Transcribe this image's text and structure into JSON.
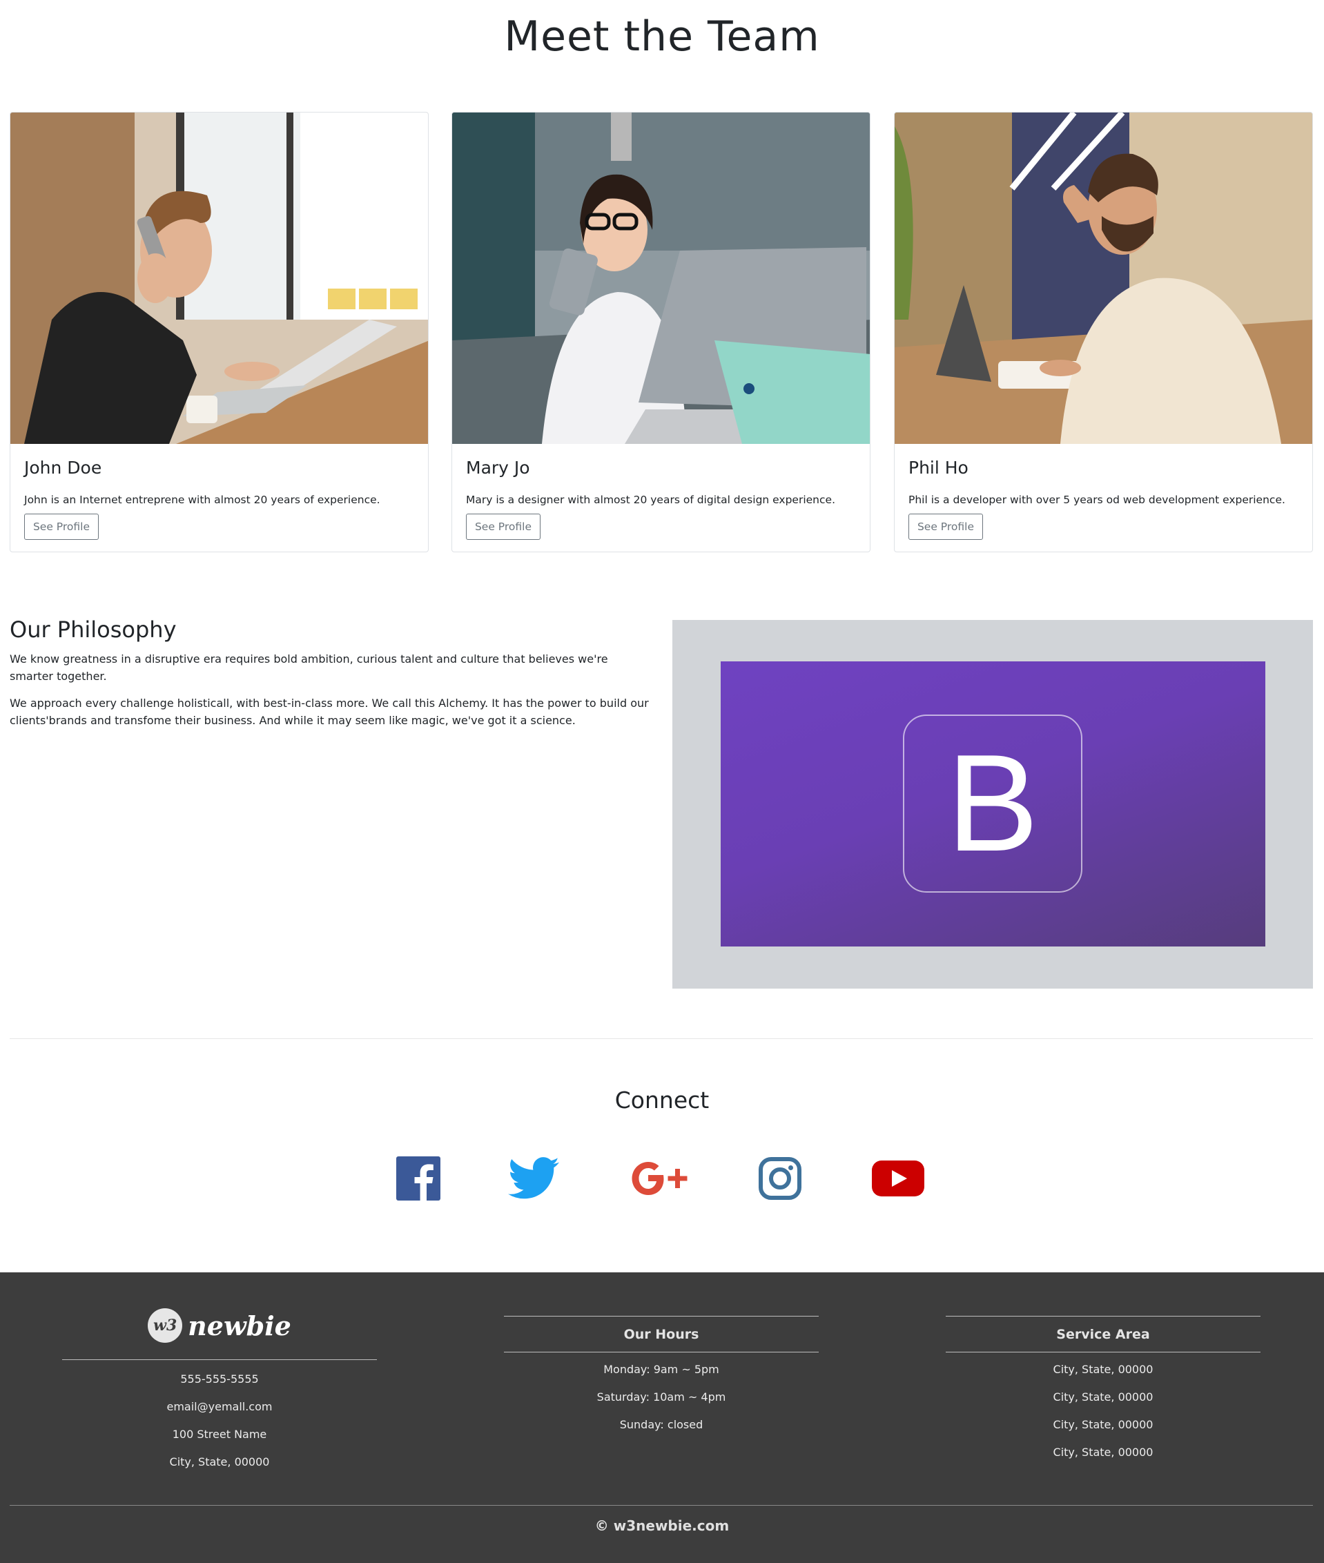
{
  "team": {
    "title": "Meet the Team",
    "members": [
      {
        "name": "John Doe",
        "description": "John is an Internet entreprene with almost 20 years of experience.",
        "button": "See Profile"
      },
      {
        "name": "Mary Jo",
        "description": "Mary is a designer with almost 20 years of digital design experience.",
        "button": "See Profile"
      },
      {
        "name": "Phil Ho",
        "description": "Phil is a developer with over 5 years od web development experience.",
        "button": "See Profile"
      }
    ]
  },
  "philosophy": {
    "title": "Our Philosophy",
    "paragraphs": [
      "We know greatness in a disruptive era requires bold ambition, curious talent and culture that believes we're smarter together.",
      "We approach every challenge holisticall, with best-in-class more. We call this Alchemy. It has the power to build our clients'brands and transfome their business. And while it may seem like magic, we've got it a science."
    ],
    "image_glyph": "B",
    "image_colors": {
      "frame": "#d1d4d8",
      "banner": "#6f42c1"
    }
  },
  "connect": {
    "title": "Connect",
    "icons": [
      "facebook-icon",
      "twitter-icon",
      "google-plus-icon",
      "instagram-icon",
      "youtube-icon"
    ],
    "colors": {
      "facebook": "#3b5998",
      "twitter": "#1da1f2",
      "google": "#dd4b39",
      "instagram": "#3f729b",
      "youtube": "#cc0000"
    }
  },
  "footer": {
    "logo": {
      "badge": "w3",
      "text": "newbie"
    },
    "contact": [
      "555-555-5555",
      "email@yemall.com",
      "100 Street Name",
      "City, State, 00000"
    ],
    "hours": {
      "title": "Our Hours",
      "lines": [
        "Monday: 9am ~ 5pm",
        "Saturday: 10am ~ 4pm",
        "Sunday: closed"
      ]
    },
    "service": {
      "title": "Service Area",
      "lines": [
        "City, State, 00000",
        "City, State, 00000",
        "City, State, 00000",
        "City, State, 00000"
      ]
    },
    "copyright": "© w3newbie.com",
    "background": "#3d3d3d"
  }
}
